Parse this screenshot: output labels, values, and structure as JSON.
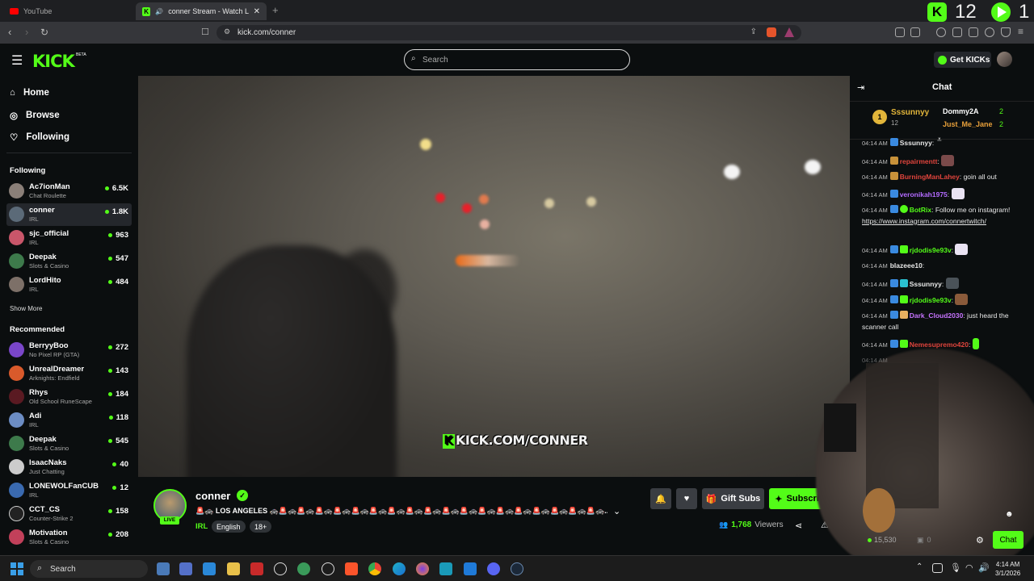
{
  "browser": {
    "tabs": [
      {
        "title": "YouTube",
        "active": false
      },
      {
        "title": "conner Stream - Watch Live o",
        "active": true
      }
    ],
    "url": "kick.com/conner",
    "overlay_numbers": {
      "left": "12",
      "right": "1"
    }
  },
  "header": {
    "logo": "KICK",
    "beta": "BETA",
    "search_placeholder": "Search",
    "get_kicks": "Get KICKs"
  },
  "sidebar": {
    "nav": [
      {
        "label": "Home",
        "icon": "home-icon"
      },
      {
        "label": "Browse",
        "icon": "compass-icon"
      },
      {
        "label": "Following",
        "icon": "heart-icon"
      }
    ],
    "following_title": "Following",
    "following": [
      {
        "name": "Ac7ionMan",
        "category": "Chat Roulette",
        "viewers": "6.5K",
        "color": "#8a7f78"
      },
      {
        "name": "conner",
        "category": "IRL",
        "viewers": "1.8K",
        "color": "#5b6a78",
        "selected": true
      },
      {
        "name": "sjc_official",
        "category": "IRL",
        "viewers": "963",
        "color": "#c9566a"
      },
      {
        "name": "Deepak",
        "category": "Slots & Casino",
        "viewers": "547",
        "color": "#3d7a4b"
      },
      {
        "name": "LordHito",
        "category": "IRL",
        "viewers": "484",
        "color": "#7d7068"
      }
    ],
    "show_more": "Show More",
    "recommended_title": "Recommended",
    "recommended": [
      {
        "name": "BerryyBoo",
        "category": "No Pixel RP (GTA)",
        "viewers": "272",
        "color": "#7a46c9"
      },
      {
        "name": "UnrealDreamer",
        "category": "Arknights: Endfield",
        "viewers": "143",
        "color": "#d95a2b"
      },
      {
        "name": "Rhys",
        "category": "Old School RuneScape",
        "viewers": "184",
        "color": "#5a1a22"
      },
      {
        "name": "Adi",
        "category": "IRL",
        "viewers": "118",
        "color": "#6c8dc4"
      },
      {
        "name": "Deepak",
        "category": "Slots & Casino",
        "viewers": "545",
        "color": "#3d7a4b"
      },
      {
        "name": "IsaacNaks",
        "category": "Just Chatting",
        "viewers": "40",
        "color": "#cccccc"
      },
      {
        "name": "LONEWOLFanCUB",
        "category": "IRL",
        "viewers": "12",
        "color": "#3a6ab0"
      },
      {
        "name": "CCT_CS",
        "category": "Counter-Strike 2",
        "viewers": "158",
        "color": "#222222"
      },
      {
        "name": "Motivation",
        "category": "Slots & Casino",
        "viewers": "208",
        "color": "#c2405a"
      }
    ]
  },
  "video": {
    "watermark": "KICK.COM/CONNER"
  },
  "stream": {
    "channel": "conner",
    "live": "LIVE",
    "title": "🚨🚓 LOS ANGELES 🚓🚨🚓🚨🚓🚨🚓🚨🚓🚨🚓🚨🚓🚨🚓🚨🚓🚨🚓🚨🚓🚨🚓🚨🚓🚨🚓🚨🚓🚨🚓🚨🚓🚨🚓🚨🚓...",
    "category": "IRL",
    "tags": [
      "English",
      "18+"
    ],
    "viewers": "1,768",
    "viewers_label": "Viewers",
    "gift_subs": "Gift Subs",
    "subscribe": "Subscribe"
  },
  "chat": {
    "title": "Chat",
    "leaderboard": [
      {
        "rank": "1",
        "name": "Sssunnyy",
        "count": "12"
      },
      {
        "name": "Dommy2A",
        "count": "2"
      },
      {
        "name": "Just_Me_Jane",
        "count": "2"
      }
    ],
    "messages": [
      {
        "time": "04:14 AM",
        "user": "Sssunnyy",
        "text": ":",
        "color": "#ffffff"
      },
      {
        "time": "04:14 AM",
        "user": "repairmentt",
        "text": ":",
        "color": "#e0443c"
      },
      {
        "time": "04:14 AM",
        "user": "BurningManLahey",
        "text": ": goin all out",
        "color": "#e0443c"
      },
      {
        "time": "04:14 AM",
        "user": "veronikah1975",
        "text": ":",
        "color": "#b36bff"
      },
      {
        "time": "04:14 AM",
        "user": "BotRix",
        "text": ": Follow me on instagram!",
        "color": "#53fc18",
        "link": "https://www.instagram.com/connertwitch/"
      },
      {
        "time": "04:14 AM",
        "user": "rjdodis9e93v",
        "text": ":",
        "color": "#53fc18"
      },
      {
        "time": "04:14 AM",
        "user": "blazeee10",
        "text": ":",
        "color": "#ffffff"
      },
      {
        "time": "04:14 AM",
        "user": "Sssunnyy",
        "text": ":",
        "color": "#ffffff"
      },
      {
        "time": "04:14 AM",
        "user": "rjdodis9e93v",
        "text": ":",
        "color": "#53fc18"
      },
      {
        "time": "04:14 AM",
        "user": "Dark_Cloud2030",
        "text": ": just heard the scanner call",
        "color": "#c774ff"
      },
      {
        "time": "04:14 AM",
        "user": "Nemesupremo420",
        "text": ":",
        "color": "#e0443c"
      },
      {
        "time": "04:14 AM",
        "user": "",
        "text": "",
        "color": "#ffffff"
      }
    ],
    "bottom_count": "15,530",
    "bottom_count2": "0",
    "chat_button": "Chat"
  },
  "taskbar": {
    "search": "Search",
    "time": "4:14 AM",
    "date": "3/1/2026"
  },
  "colors": {
    "accent": "#53fc18",
    "bg": "#0b0e0f",
    "panel": "#24272c"
  }
}
